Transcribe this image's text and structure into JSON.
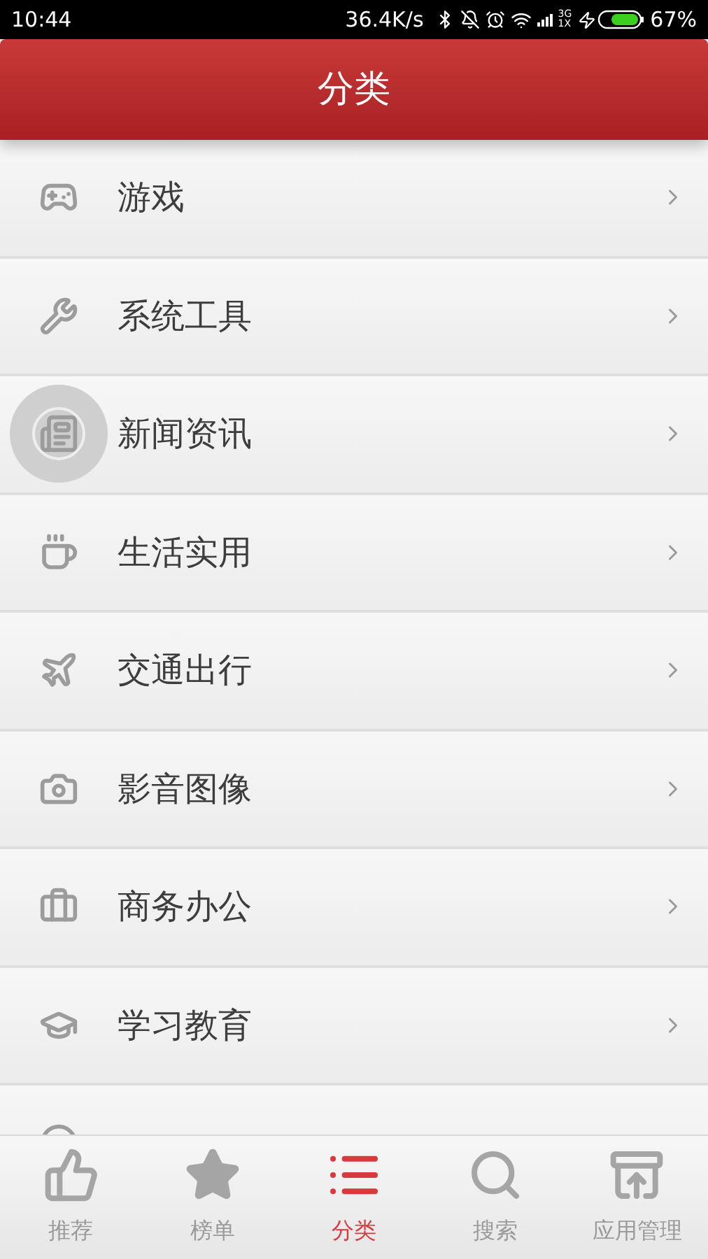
{
  "status_bar": {
    "time": "10:44",
    "speed": "36.4K/s",
    "network_top": "3G",
    "network_bottom": "1X",
    "battery": "67%"
  },
  "header": {
    "title": "分类"
  },
  "categories": [
    {
      "label": "游戏",
      "pressed": false
    },
    {
      "label": "系统工具",
      "pressed": false
    },
    {
      "label": "新闻资讯",
      "pressed": true
    },
    {
      "label": "生活实用",
      "pressed": false
    },
    {
      "label": "交通出行",
      "pressed": false
    },
    {
      "label": "影音图像",
      "pressed": false
    },
    {
      "label": "商务办公",
      "pressed": false
    },
    {
      "label": "学习教育",
      "pressed": false
    },
    {
      "pressed": false
    }
  ],
  "tabs": [
    {
      "label": "推荐",
      "selected": false
    },
    {
      "label": "榜单",
      "selected": false
    },
    {
      "label": "分类",
      "selected": true
    },
    {
      "label": "搜索",
      "selected": false
    },
    {
      "label": "应用管理",
      "selected": false
    }
  ]
}
